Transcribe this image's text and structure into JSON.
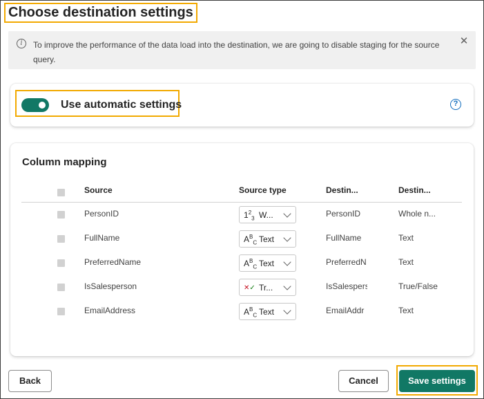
{
  "dialog": {
    "title": "Choose destination settings"
  },
  "banner": {
    "info_icon": "info-icon",
    "text": "To improve the performance of the data load into the destination, we are going to disable staging for the source query.",
    "close_icon": "close-icon"
  },
  "auto_settings": {
    "toggle_on": true,
    "label": "Use automatic settings",
    "help_icon": "question-circle-icon",
    "accent_color": "#117865"
  },
  "mapping": {
    "title": "Column mapping",
    "headers": {
      "source": "Source",
      "source_type": "Source type",
      "dest1": "Destin...",
      "dest2": "Destin..."
    },
    "rows": [
      {
        "source": "PersonID",
        "type_icon": "1²₃",
        "type": "W...",
        "dest_col": "PersonID",
        "dest_type": "Whole n..."
      },
      {
        "source": "FullName",
        "type_icon": "ᴬᴮc",
        "type": "Text",
        "dest_col": "FullName",
        "dest_type": "Text"
      },
      {
        "source": "PreferredName",
        "type_icon": "ᴬᴮc",
        "type": "Text",
        "dest_col": "PreferredN",
        "dest_type": "Text"
      },
      {
        "source": "IsSalesperson",
        "type_icon": "✕✓",
        "type": "Tr...",
        "dest_col": "IsSalespers",
        "dest_type": "True/False"
      },
      {
        "source": "EmailAddress",
        "type_icon": "ᴬᴮc",
        "type": "Text",
        "dest_col": "EmailAddr",
        "dest_type": "Text"
      }
    ]
  },
  "footer": {
    "back": "Back",
    "cancel": "Cancel",
    "save": "Save settings"
  }
}
